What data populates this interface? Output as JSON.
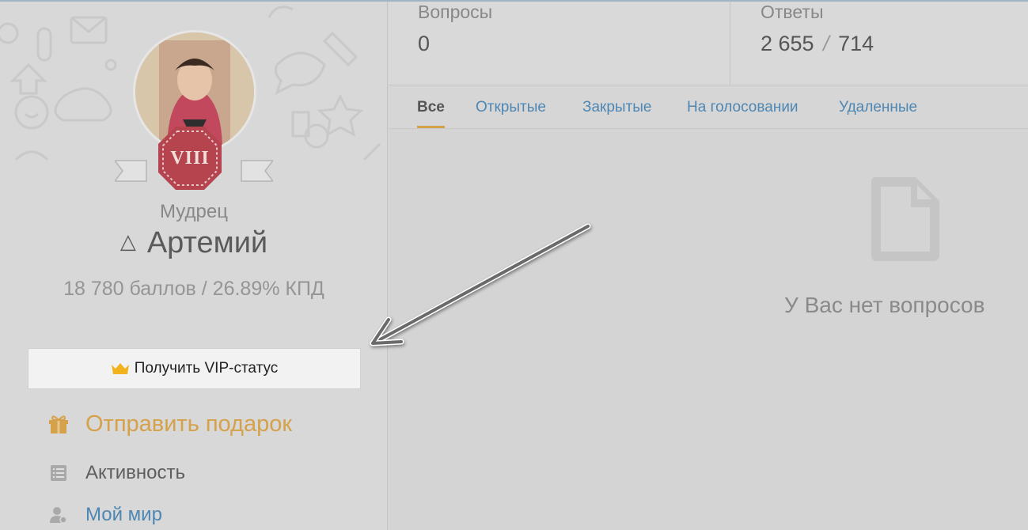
{
  "profile": {
    "rank_numeral": "VIII",
    "rank_title": "Мудрец",
    "name_symbol": "△",
    "name": "Артемий",
    "score": "18 780 баллов / 26.89% КПД"
  },
  "vip_button": {
    "label": "Получить VIP-статус",
    "icon": "crown-icon"
  },
  "menu": {
    "gift": {
      "label": "Отправить подарок",
      "icon": "gift-icon"
    },
    "activity": {
      "label": "Активность",
      "icon": "list-icon"
    },
    "myworld": {
      "label": "Мой мир",
      "icon": "user-icon"
    }
  },
  "stats": {
    "questions": {
      "label": "Вопросы",
      "value": "0"
    },
    "answers": {
      "label": "Ответы",
      "value_a": "2 655",
      "separator": "/",
      "value_b": "714"
    }
  },
  "tabs": [
    {
      "label": "Все",
      "active": true
    },
    {
      "label": "Открытые"
    },
    {
      "label": "Закрытые"
    },
    {
      "label": "На голосовании"
    },
    {
      "label": "Удаленные"
    }
  ],
  "empty_state": {
    "text": "У Вас нет вопросов",
    "icon": "document-icon"
  },
  "colors": {
    "accent_gold": "#d5a14a",
    "link_blue": "#4f87b3",
    "badge_red": "#b5444f"
  }
}
